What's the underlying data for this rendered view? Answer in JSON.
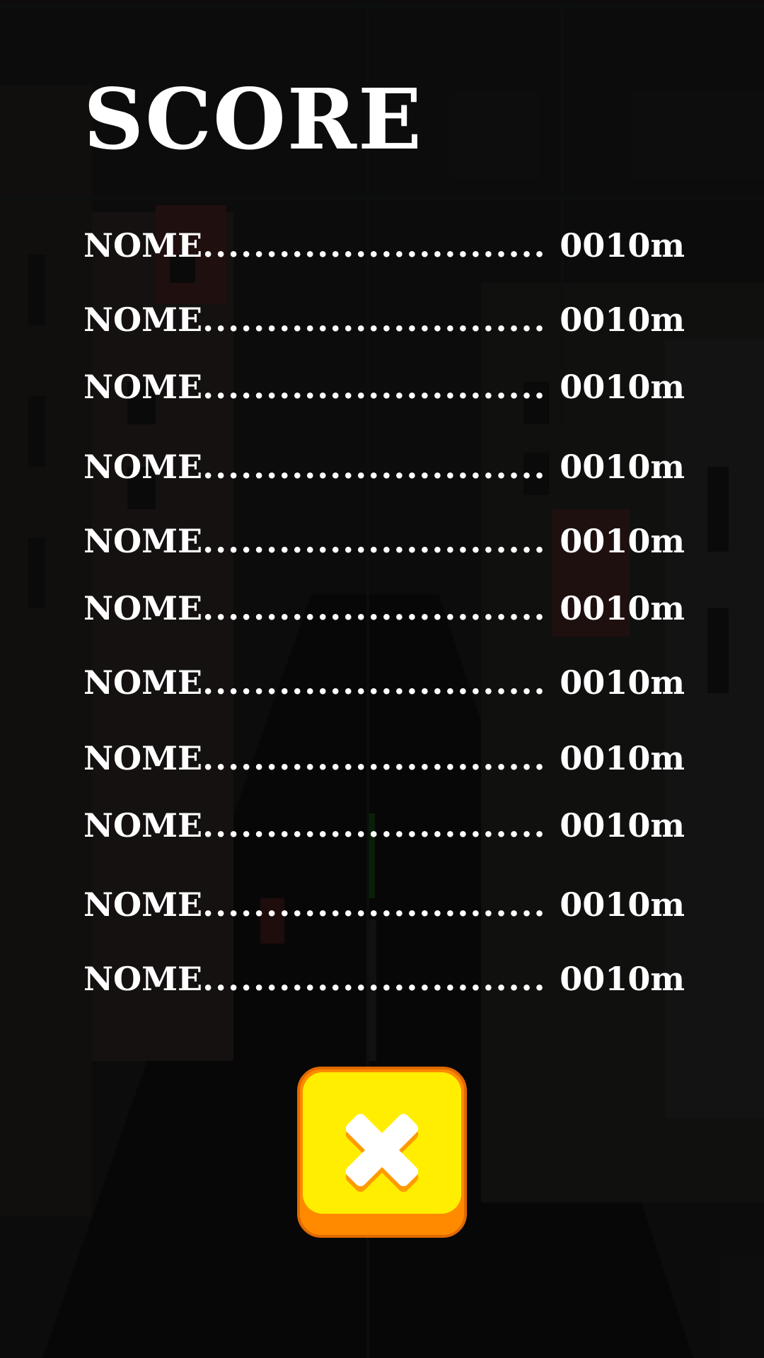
{
  "screen": {
    "title": "SCORE"
  },
  "scores": [
    {
      "name": "NOME",
      "dots": "...........................",
      "distance": "0010m"
    },
    {
      "name": "NOME",
      "dots": "...........................",
      "distance": "0010m"
    },
    {
      "name": "NOME",
      "dots": "...........................",
      "distance": "0010m"
    },
    {
      "name": "NOME",
      "dots": "...........................",
      "distance": "0010m"
    },
    {
      "name": "NOME",
      "dots": "...........................",
      "distance": "0010m"
    },
    {
      "name": "NOME",
      "dots": "...........................",
      "distance": "0010m"
    },
    {
      "name": "NOME",
      "dots": "...........................",
      "distance": "0010m"
    },
    {
      "name": "NOME",
      "dots": "...........................",
      "distance": "0010m"
    },
    {
      "name": "NOME",
      "dots": "...........................",
      "distance": "0010m"
    },
    {
      "name": "NOME",
      "dots": "...........................",
      "distance": "0010m"
    },
    {
      "name": "NOME",
      "dots": "...........................",
      "distance": "0010m"
    }
  ],
  "close_button": {
    "icon": "close-icon",
    "face_color": "#ffee00",
    "edge_color": "#ff8a00"
  }
}
